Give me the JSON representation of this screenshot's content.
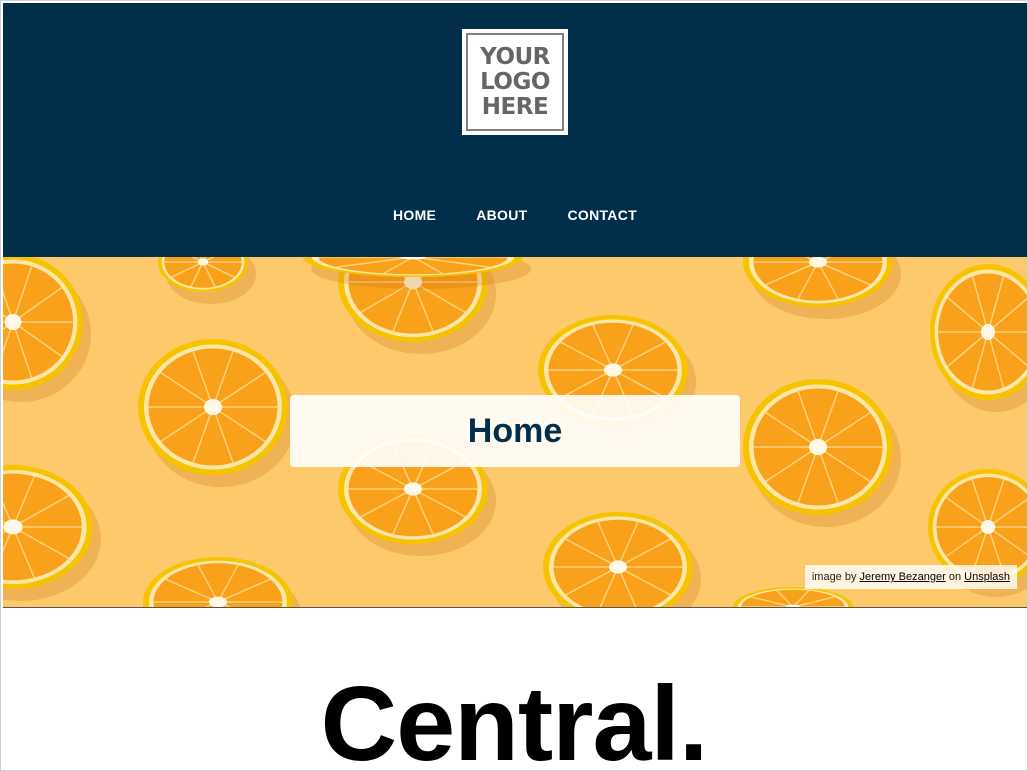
{
  "logo": {
    "lines": [
      "YOUR",
      "LOGO",
      "HERE"
    ]
  },
  "nav": {
    "items": [
      {
        "label": "HOME"
      },
      {
        "label": "ABOUT"
      },
      {
        "label": "CONTACT"
      }
    ]
  },
  "hero": {
    "title": "Home",
    "credit": {
      "prefix": "image by",
      "author": "Jeremy Bezanger",
      "on": "on",
      "site": "Unsplash"
    }
  },
  "main": {
    "heading": "Central."
  },
  "colors": {
    "header_bg": "#002e4b",
    "hero_bg": "#fdc96a",
    "orange": "#f9a11b",
    "rind": "#f7c300"
  }
}
